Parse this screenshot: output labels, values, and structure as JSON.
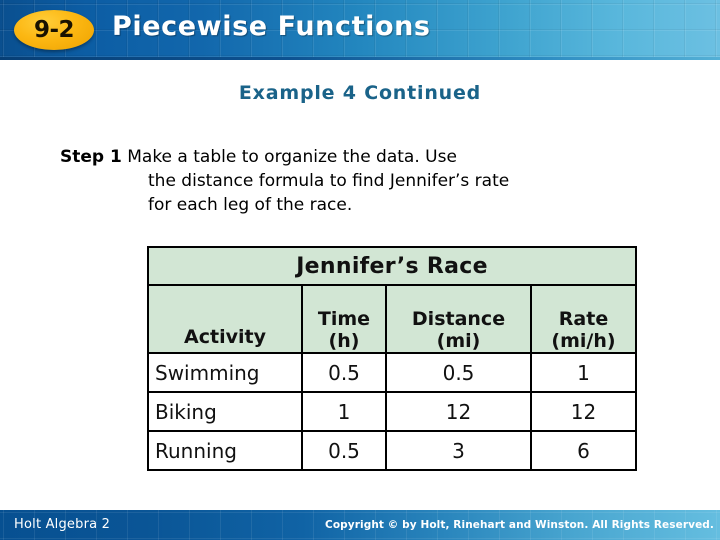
{
  "header": {
    "lesson_number": "9-2",
    "title": "Piecewise Functions",
    "badge_color": "#fcb712",
    "bar_color_left": "#0a4f8f",
    "bar_color_right": "#6cc0e2"
  },
  "slide": {
    "example_title": "Example 4 Continued",
    "example_title_color": "#1a6389",
    "step": {
      "label": "Step 1",
      "line1": "Make a table to organize the data. Use",
      "line2": "the distance formula to find Jennifer’s rate",
      "line3": "for each leg of the race."
    }
  },
  "table": {
    "title": "Jennifer’s Race",
    "header_bg": "#d2e6d4",
    "columns": [
      {
        "label_line1": "",
        "label_line2": "Activity"
      },
      {
        "label_line1": "Time",
        "label_line2": "(h)"
      },
      {
        "label_line1": "Distance",
        "label_line2": "(mi)"
      },
      {
        "label_line1": "Rate",
        "label_line2": "(mi/h)"
      }
    ],
    "rows": [
      {
        "activity": "Swimming",
        "time": "0.5",
        "distance": "0.5",
        "rate": "1"
      },
      {
        "activity": "Biking",
        "time": "1",
        "distance": "12",
        "rate": "12"
      },
      {
        "activity": "Running",
        "time": "0.5",
        "distance": "3",
        "rate": "6"
      }
    ]
  },
  "footer": {
    "book": "Holt Algebra 2",
    "copyright": "Copyright © by Holt, Rinehart and Winston. All Rights Reserved."
  }
}
